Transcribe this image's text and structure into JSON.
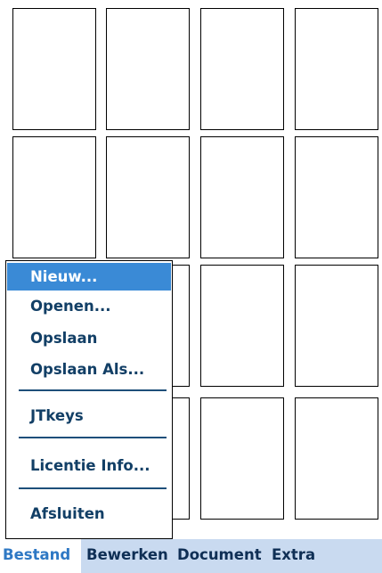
{
  "menu": {
    "items": [
      {
        "label": "Nieuw...",
        "selected": true
      },
      {
        "label": "Openen..."
      },
      {
        "label": "Opslaan"
      },
      {
        "label": "Opslaan Als..."
      },
      {
        "label": "JTkeys"
      },
      {
        "label": "Licentie Info..."
      },
      {
        "label": "Afsluiten"
      }
    ]
  },
  "menubar": {
    "bestand": "Bestand",
    "bewerken": "Bewerken",
    "document": "Document",
    "extra": "Extra"
  },
  "colors": {
    "accent": "#3a8ad6",
    "menu_text": "#123f66",
    "bar_background": "#c9daf0"
  }
}
